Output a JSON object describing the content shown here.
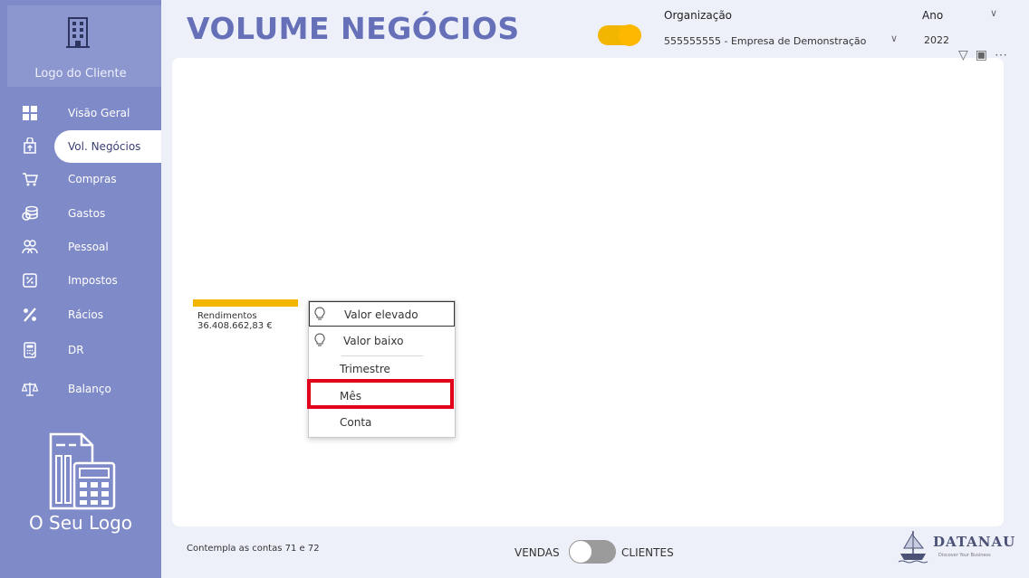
{
  "sidebar": {
    "client_logo_text": "Logo do Cliente",
    "items": [
      {
        "label": "Visão Geral",
        "icon": "grid-icon"
      },
      {
        "label": "Vol. Negócios",
        "icon": "bag-up-icon",
        "active": true
      },
      {
        "label": "Compras",
        "icon": "cart-icon"
      },
      {
        "label": "Gastos",
        "icon": "coins-icon"
      },
      {
        "label": "Pessoal",
        "icon": "people-icon"
      },
      {
        "label": "Impostos",
        "icon": "tax-icon"
      },
      {
        "label": "Rácios",
        "icon": "percent-icon"
      },
      {
        "label": "DR",
        "icon": "calculator-icon"
      },
      {
        "label": "Balanço",
        "icon": "scale-icon"
      }
    ],
    "your_logo_text": "O Seu Logo"
  },
  "header": {
    "title": "VOLUME NEGÓCIOS",
    "organizacao_label": "Organização",
    "organizacao_value": "555555555 - Empresa de Demonstração",
    "ano_label": "Ano",
    "ano_value": "2022"
  },
  "chart": {
    "bar_label": "Rendimentos",
    "bar_value": "36.408.662,83 €"
  },
  "context_menu": {
    "items": [
      "Valor elevado",
      "Valor baixo",
      "Trimestre",
      "Mês",
      "Conta"
    ]
  },
  "footer": {
    "note": "Contempla as contas 71 e 72",
    "left_label": "VENDAS",
    "right_label": "CLIENTES",
    "brand": "DATANAU",
    "tagline": "Discover Your Business"
  },
  "colors": {
    "sidebar": "#7f8ac8",
    "accent": "#f2b600",
    "title": "#6670b8",
    "highlight": "#e3001b"
  }
}
